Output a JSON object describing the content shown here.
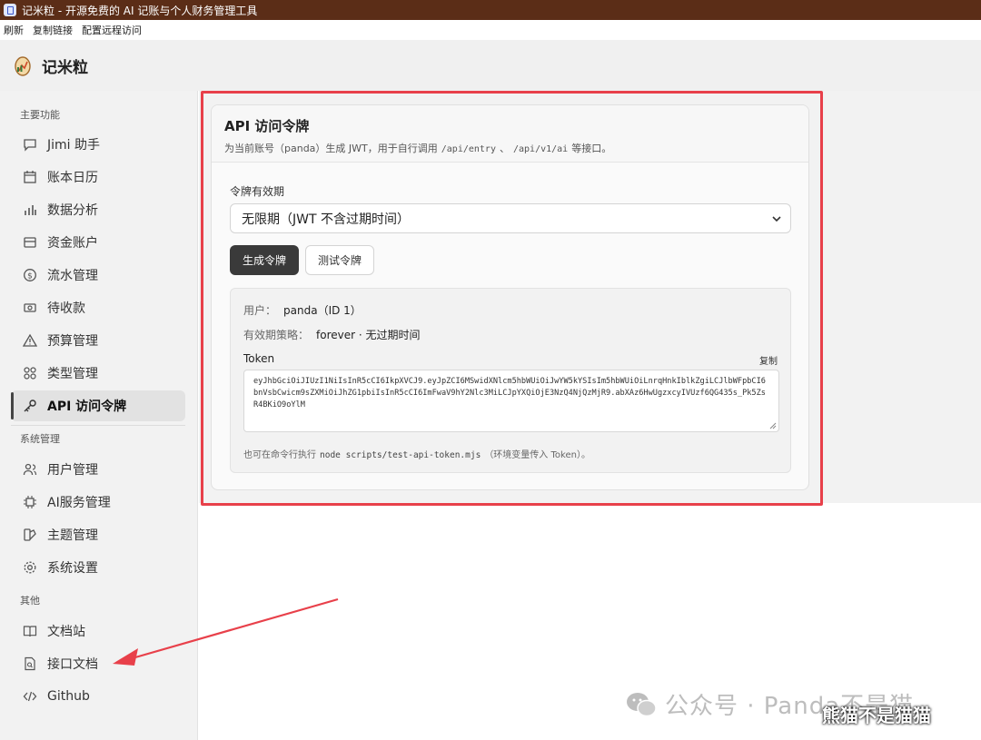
{
  "window": {
    "title": "记米粒 - 开源免费的 AI 记账与个人财务管理工具"
  },
  "menubar": {
    "items": [
      "刷新",
      "复制链接",
      "配置远程访问"
    ]
  },
  "header": {
    "brand": "记米粒"
  },
  "sidebar": {
    "sections": [
      {
        "label": "主要功能",
        "items": [
          {
            "label": "Jimi 助手",
            "icon": "chat-icon"
          },
          {
            "label": "账本日历",
            "icon": "calendar-icon"
          },
          {
            "label": "数据分析",
            "icon": "bar-chart-icon"
          },
          {
            "label": "资金账户",
            "icon": "wallet-icon"
          },
          {
            "label": "流水管理",
            "icon": "dollar-icon"
          },
          {
            "label": "待收款",
            "icon": "receivable-icon"
          },
          {
            "label": "预算管理",
            "icon": "warning-icon"
          },
          {
            "label": "类型管理",
            "icon": "grid-icon"
          },
          {
            "label": "API 访问令牌",
            "icon": "key-icon",
            "active": true
          }
        ]
      },
      {
        "label": "系统管理",
        "items": [
          {
            "label": "用户管理",
            "icon": "users-icon"
          },
          {
            "label": "AI服务管理",
            "icon": "chip-icon"
          },
          {
            "label": "主题管理",
            "icon": "palette-icon"
          },
          {
            "label": "系统设置",
            "icon": "gear-icon"
          }
        ]
      },
      {
        "label": "其他",
        "items": [
          {
            "label": "文档站",
            "icon": "book-icon"
          },
          {
            "label": "接口文档",
            "icon": "file-search-icon"
          },
          {
            "label": "Github",
            "icon": "code-icon"
          }
        ]
      }
    ]
  },
  "card": {
    "title": "API 访问令牌",
    "desc_prefix": "为当前账号（panda）生成 JWT，用于自行调用",
    "endpoint1": "/api/entry",
    "desc_sep": "、",
    "endpoint2": "/api/v1/ai",
    "desc_suffix": "等接口。",
    "validity_label": "令牌有效期",
    "validity_value": "无限期（JWT 不含过期时间）",
    "generate_button": "生成令牌",
    "test_button": "测试令牌",
    "user_label": "用户：",
    "user_value": "panda（ID 1）",
    "policy_label": "有效期策略：",
    "policy_value": "forever · 无过期时间",
    "token_label": "Token",
    "copy_label": "复制",
    "token_value": "eyJhbGciOiJIUzI1NiIsInR5cCI6IkpXVCJ9.eyJpZCI6MSwidXNlcm5hbWUiOiJwYW5kYSIsIm5hbWUiOiLnrqHnkIblkZgiLCJlbWFpbCI6bnVsbCwicm9sZXMiOiJhZG1pbiIsInR5cCI6ImFwaV9hY2Nlc3MiLCJpYXQiOjE3NzQ4NjQzMjR9.abXAz6HwUgzxcyIVUzf6QG435s_Pk5ZsR4BKiO9oYlM",
    "hint_prefix": "也可在命令行执行",
    "hint_cmd": "node scripts/test-api-token.mjs",
    "hint_suffix": "（环境变量传入 Token）。"
  },
  "watermark": {
    "text": "公众号 · Panda不是猫",
    "overlay": "熊猫不是猫猫"
  },
  "colors": {
    "annotation": "#e8404a",
    "titlebar": "#5b2d17",
    "primary_button": "#3a3a3a"
  }
}
